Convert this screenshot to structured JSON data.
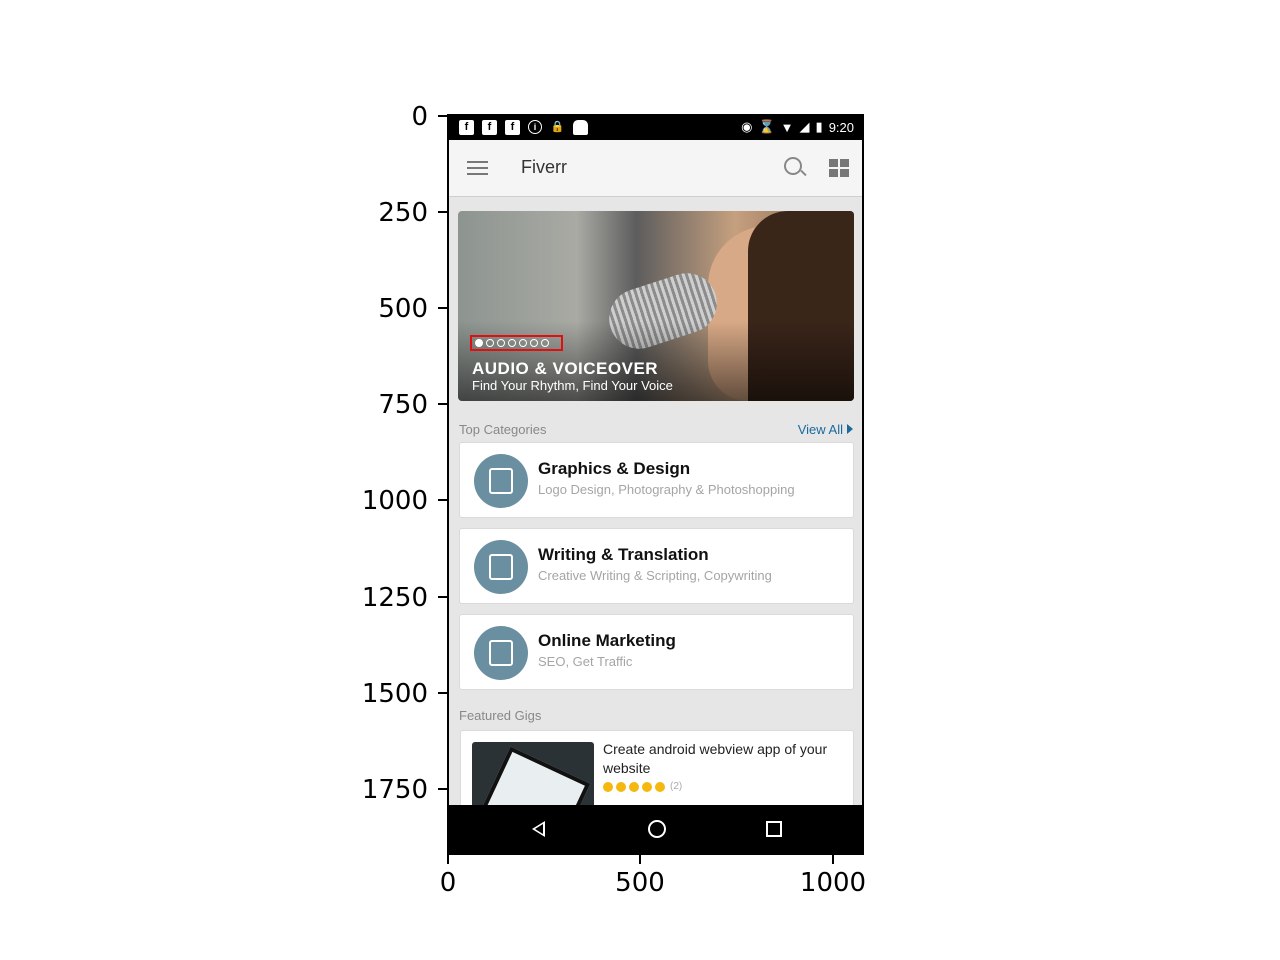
{
  "axes": {
    "y_ticks": [
      "0",
      "250",
      "500",
      "750",
      "1000",
      "1250",
      "1500",
      "1750"
    ],
    "x_ticks": [
      "0",
      "500",
      "1000"
    ]
  },
  "status_bar": {
    "time": "9:20",
    "left_icons": [
      "facebook-icon",
      "facebook-icon",
      "facebook-icon",
      "info-icon",
      "lock-icon",
      "android-icon"
    ],
    "right_icons": [
      "location-icon",
      "bluetooth-icon",
      "wifi-icon",
      "no-signal-icon",
      "battery-icon"
    ]
  },
  "app_bar": {
    "title": "Fiverr",
    "icons": [
      "menu-icon",
      "search-icon",
      "grid-view-icon"
    ]
  },
  "hero": {
    "title": "AUDIO & VOICEOVER",
    "subtitle": "Find Your Rhythm, Find Your Voice",
    "dots_total": 7,
    "active_dot": 1
  },
  "top_categories": {
    "label": "Top Categories",
    "view_all": "View All",
    "items": [
      {
        "name": "Graphics & Design",
        "sub": "Logo Design, Photography & Photoshopping",
        "icon": "pencil-ruler-icon"
      },
      {
        "name": "Writing & Translation",
        "sub": "Creative Writing & Scripting, Copywriting",
        "icon": "typewriter-icon"
      },
      {
        "name": "Online Marketing",
        "sub": "SEO, Get Traffic",
        "icon": "laptop-chart-icon"
      }
    ]
  },
  "featured_gigs": {
    "label": "Featured Gigs",
    "items": [
      {
        "title": "Create android webview app of your website",
        "rating_stars": 5,
        "reviews": "(2)"
      }
    ]
  },
  "nav_bar": {
    "icons": [
      "back-icon",
      "home-icon",
      "recents-icon"
    ]
  },
  "colors": {
    "accent": "#1a6aa0",
    "category_circle": "#6a8fa1",
    "star": "#f5b80f",
    "highlight_box": "#e01010"
  }
}
